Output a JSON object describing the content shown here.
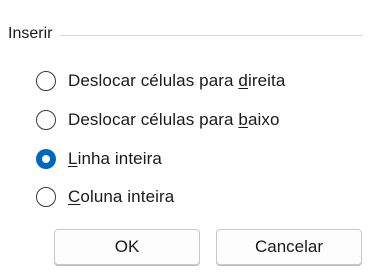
{
  "group": {
    "title": "Inserir"
  },
  "options": [
    {
      "before": "Deslocar células para ",
      "mnemonic": "d",
      "after": "ireita",
      "checked": false
    },
    {
      "before": "Deslocar células para ",
      "mnemonic": "b",
      "after": "aixo",
      "checked": false
    },
    {
      "before": "",
      "mnemonic": "L",
      "after": "inha inteira",
      "checked": true
    },
    {
      "before": "",
      "mnemonic": "C",
      "after": "oluna inteira",
      "checked": false
    }
  ],
  "buttons": {
    "ok_label": "OK",
    "cancel_label": "Cancelar"
  },
  "colors": {
    "accent": "#0067c0",
    "separator": "#d9d9d9"
  }
}
